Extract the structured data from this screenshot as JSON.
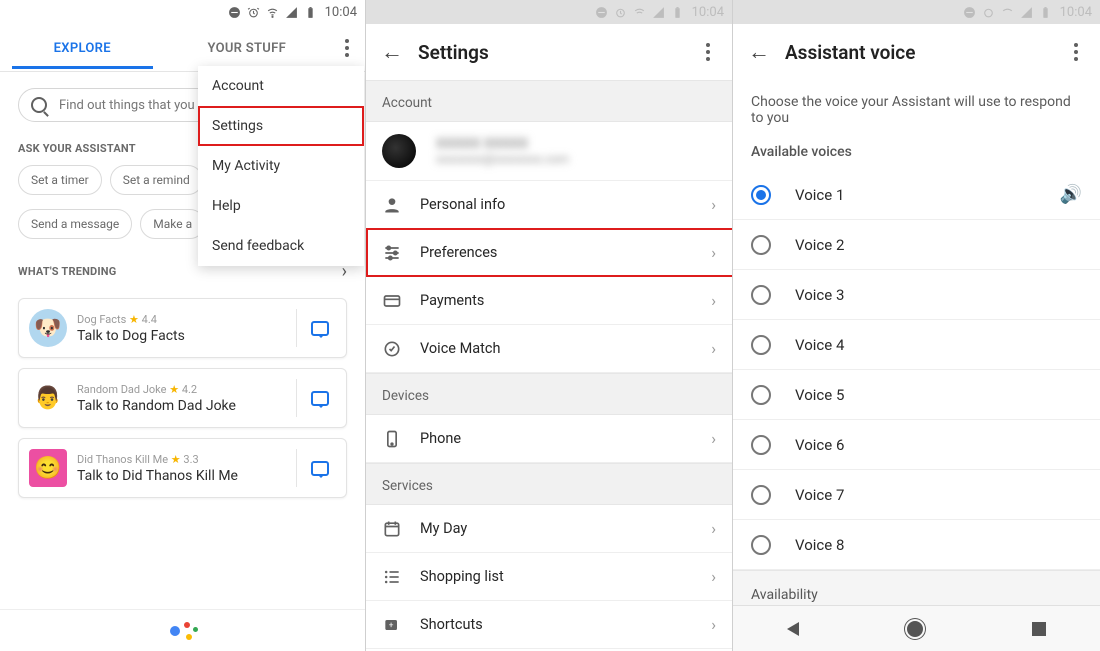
{
  "status_time": "10:04",
  "panel1": {
    "tab_explore": "EXPLORE",
    "tab_yourstuff": "YOUR STUFF",
    "search_placeholder": "Find out things that you",
    "ask_label": "ASK YOUR ASSISTANT",
    "chips_row1": [
      "Set a timer",
      "Set a remind"
    ],
    "chips_row2": [
      "Send a message",
      "Make a"
    ],
    "trending_label": "WHAT'S TRENDING",
    "cards": [
      {
        "meta": "Dog Facts",
        "rating": "4.4",
        "title": "Talk to Dog Facts"
      },
      {
        "meta": "Random Dad Joke",
        "rating": "4.2",
        "title": "Talk to Random Dad Joke"
      },
      {
        "meta": "Did Thanos Kill Me",
        "rating": "3.3",
        "title": "Talk to Did Thanos Kill Me"
      }
    ],
    "menu": {
      "account": "Account",
      "settings": "Settings",
      "activity": "My Activity",
      "help": "Help",
      "feedback": "Send feedback"
    }
  },
  "panel2": {
    "title": "Settings",
    "sec_account": "Account",
    "acct_name": "XXXXX XXXXX",
    "acct_email": "xxxxxxxx@xxxxxxxx.com",
    "item_personal": "Personal info",
    "item_prefs": "Preferences",
    "item_pay": "Payments",
    "item_voicematch": "Voice Match",
    "sec_devices": "Devices",
    "item_phone": "Phone",
    "sec_services": "Services",
    "item_myday": "My Day",
    "item_shopping": "Shopping list",
    "item_shortcuts": "Shortcuts"
  },
  "panel3": {
    "title": "Assistant voice",
    "subtitle": "Choose the voice your Assistant will use to respond to you",
    "available": "Available voices",
    "voices": [
      "Voice 1",
      "Voice 2",
      "Voice 3",
      "Voice 4",
      "Voice 5",
      "Voice 6",
      "Voice 7",
      "Voice 8"
    ],
    "availability": "Availability"
  }
}
